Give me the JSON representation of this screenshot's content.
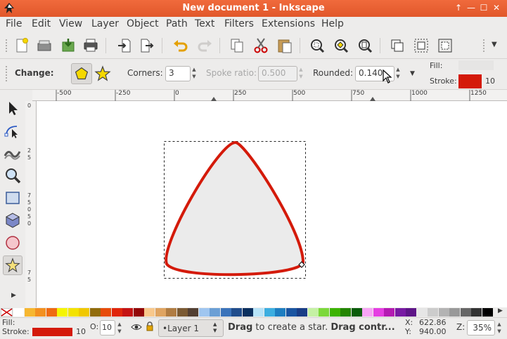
{
  "window": {
    "title": "New document 1 - Inkscape"
  },
  "menu": [
    "File",
    "Edit",
    "View",
    "Layer",
    "Object",
    "Path",
    "Text",
    "Filters",
    "Extensions",
    "Help"
  ],
  "tool_controls": {
    "change_label": "Change:",
    "corners_label": "Corners:",
    "corners_value": "3",
    "spoke_ratio_label": "Spoke ratio:",
    "spoke_ratio_value": "0.500",
    "rounded_label": "Rounded:",
    "rounded_value": "0.140",
    "fill_label": "Fill:",
    "stroke_label": "Stroke:",
    "stroke_width": "10",
    "stroke_color": "#d41a0a"
  },
  "ruler": {
    "top_ticks": [
      "-500",
      "-250",
      "0",
      "250",
      "500",
      "750",
      "1000",
      "1250"
    ],
    "left_ticks": [
      "0",
      "2",
      "5",
      "7",
      "5",
      "0",
      "5",
      "0",
      "7",
      "5"
    ]
  },
  "palette": [
    "#ffffff",
    "#f6b731",
    "#f39020",
    "#ef6a12",
    "#f5f500",
    "#f3e200",
    "#f0c800",
    "#916c0b",
    "#e74c0a",
    "#e0260b",
    "#c51313",
    "#920808",
    "#f8c88c",
    "#dfa461",
    "#b07c42",
    "#7b5a33",
    "#534033",
    "#9fc6f0",
    "#6b9fd5",
    "#3b73ba",
    "#214d8c",
    "#0a2f5e",
    "#b6e3f8",
    "#3caee0",
    "#1e7ec1",
    "#1a55a1",
    "#193d86",
    "#c5f1a4",
    "#7cd83b",
    "#3cb300",
    "#238500",
    "#0a5c0a",
    "#f7a5f5",
    "#e53ee2",
    "#b41ab2",
    "#781aa3",
    "#5e1587",
    "#e6e6e6",
    "#cccccc",
    "#b3b3b3",
    "#999999",
    "#666666",
    "#333333",
    "#000000"
  ],
  "status": {
    "fill_label": "Fill:",
    "stroke_label": "Stroke:",
    "stroke_color": "#d41a0a",
    "stroke_width": "10",
    "opacity_label": "O:",
    "opacity_value": "10",
    "layer_name": "•Layer 1",
    "message_bold": "Drag",
    "message_rest": " to create a star. ",
    "message_bold2": "Drag contr...",
    "x_label": "X:",
    "x_value": "622.86",
    "y_label": "Y:",
    "y_value": "940.00",
    "zoom_label": "Z:",
    "zoom_value": "35%"
  }
}
